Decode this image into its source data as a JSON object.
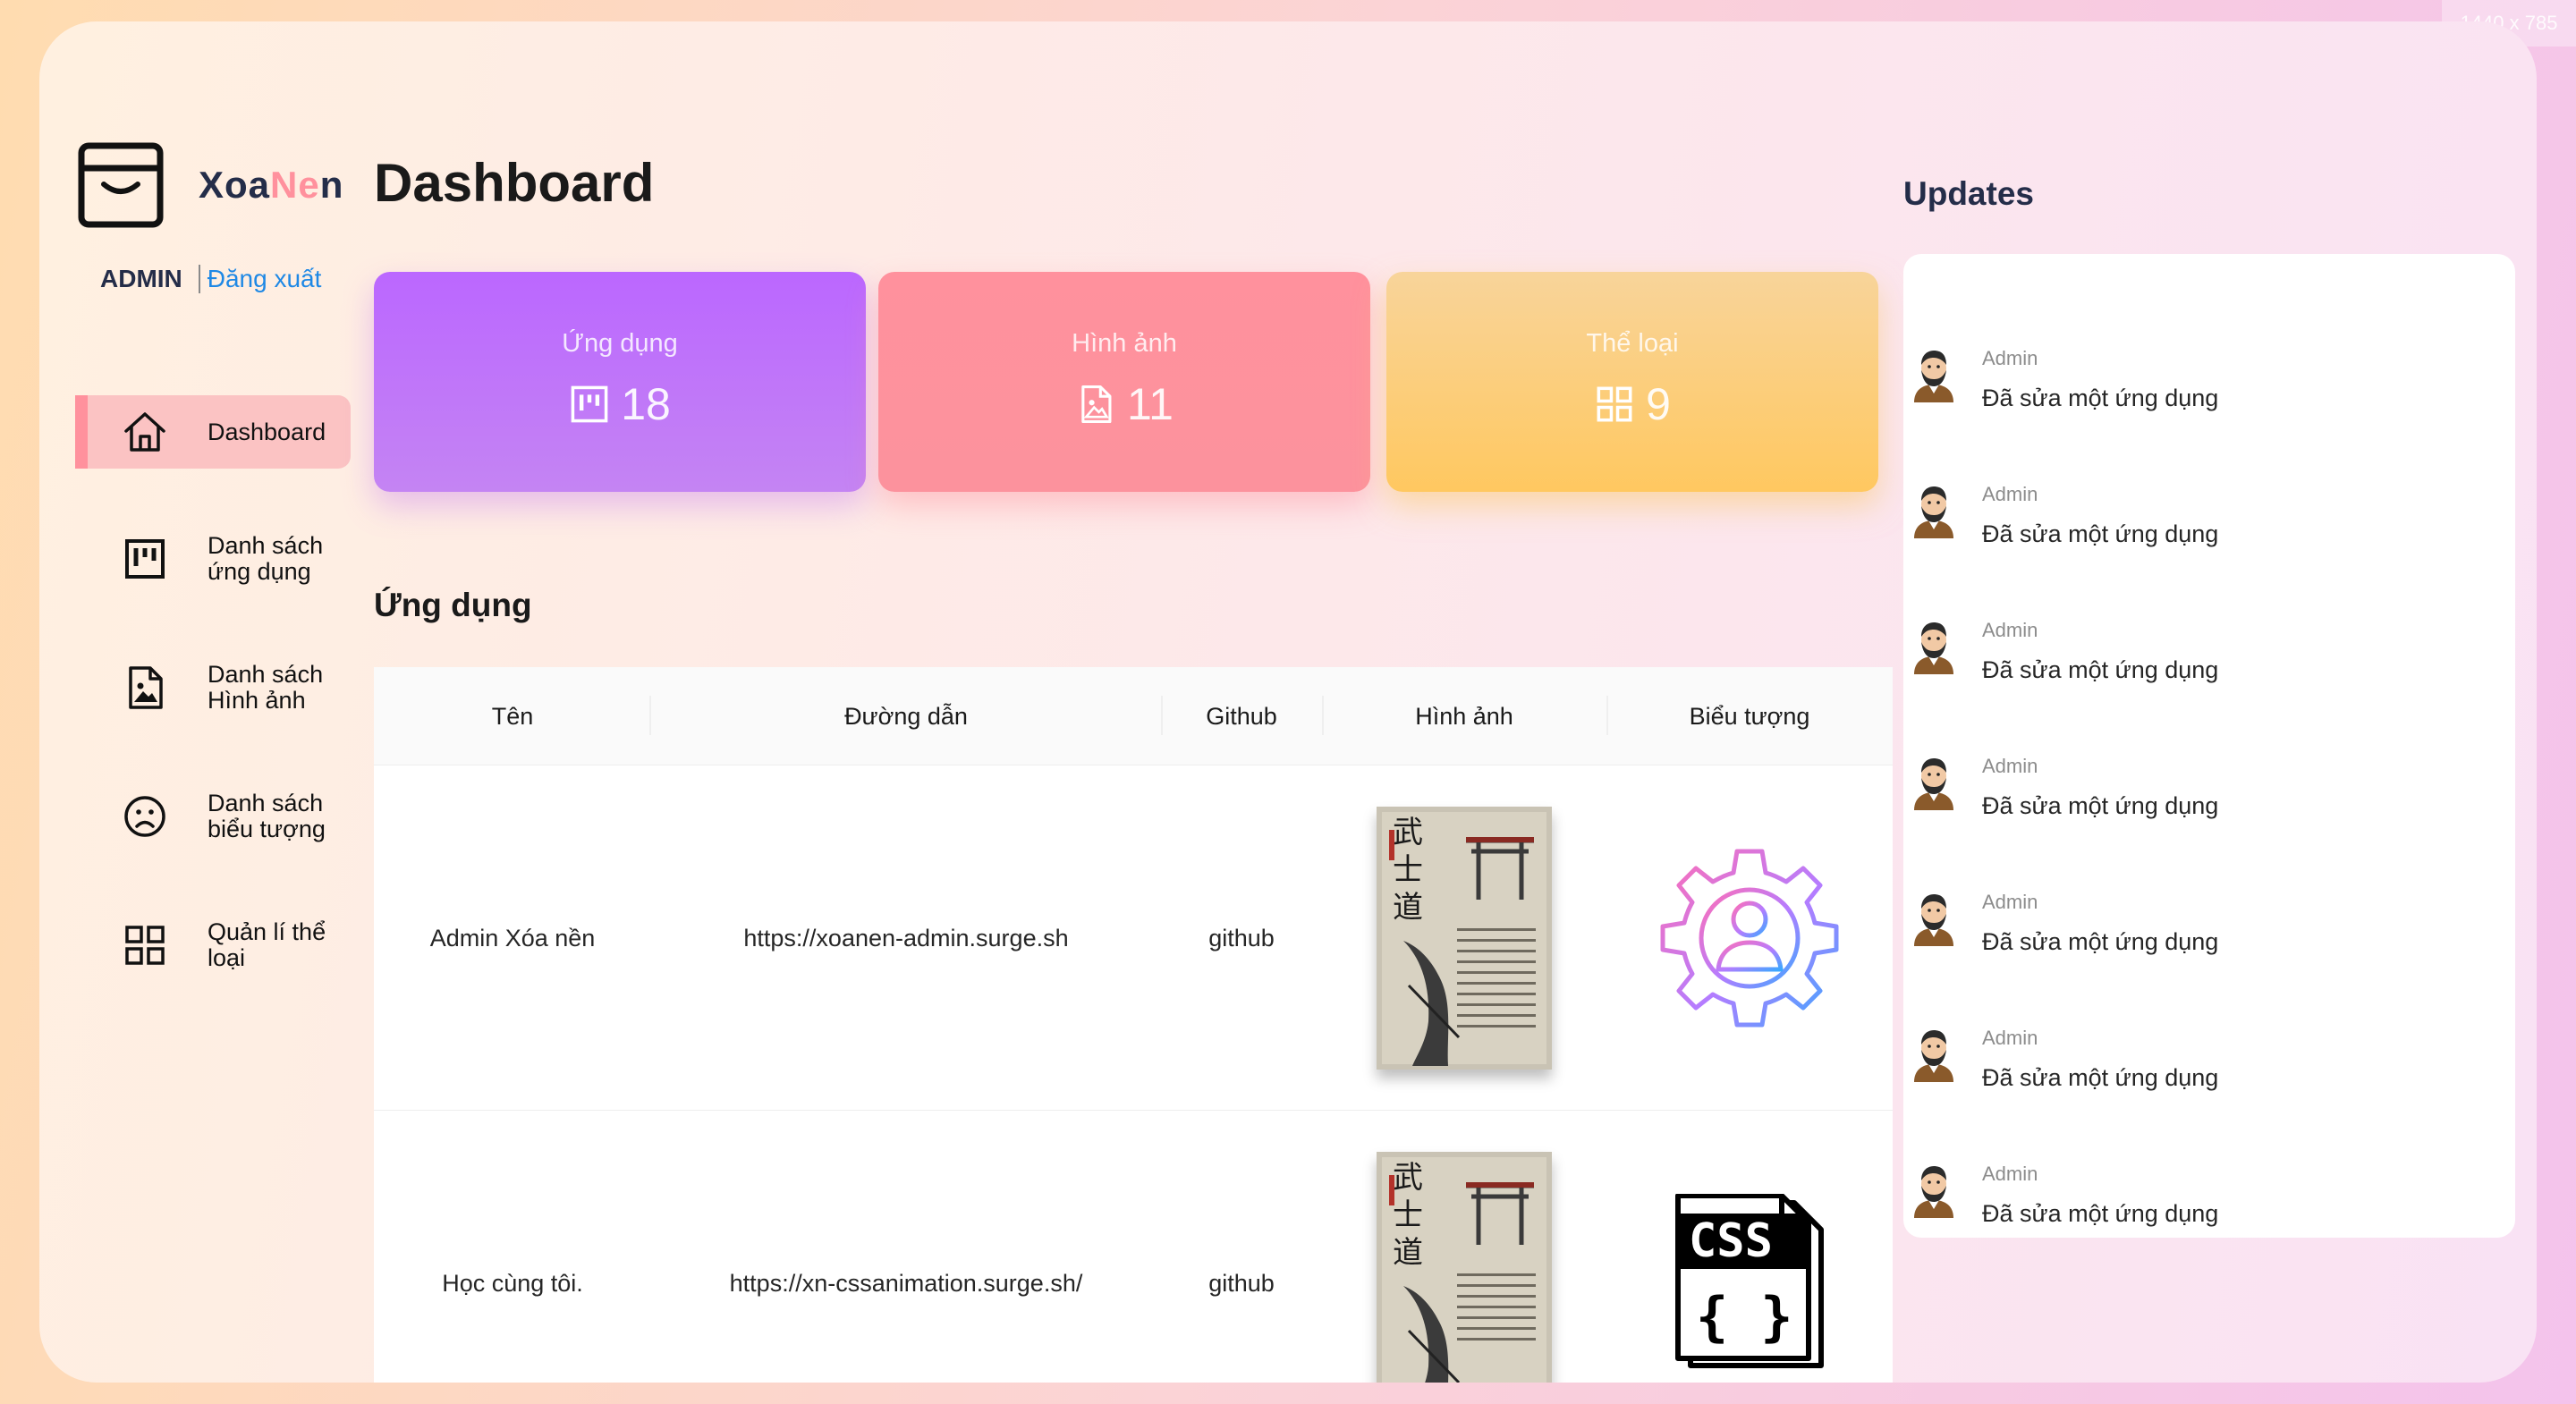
{
  "size_badge": "1440 x 785",
  "brand": {
    "part1": "Xoa",
    "part2": "Ne",
    "part3": "n"
  },
  "user": {
    "name": "ADMIN",
    "logout": "Đăng xuất"
  },
  "sidebar": {
    "items": [
      {
        "label": "Dashboard",
        "icon": "home-icon",
        "active": true
      },
      {
        "label": "Danh sách ứng dụng",
        "icon": "kanban-icon",
        "active": false
      },
      {
        "label": "Danh sách Hình ảnh",
        "icon": "image-file-icon",
        "active": false
      },
      {
        "label": "Danh sách biểu tượng",
        "icon": "sad-face-icon",
        "active": false
      },
      {
        "label": "Quản lí thể loại",
        "icon": "grid-icon",
        "active": false
      }
    ]
  },
  "page": {
    "title": "Dashboard"
  },
  "cards": [
    {
      "title": "Ứng dụng",
      "value": "18",
      "icon": "kanban-icon",
      "color": "#bb67ff"
    },
    {
      "title": "Hình ảnh",
      "value": "11",
      "icon": "image-file-icon",
      "color": "#ff919d"
    },
    {
      "title": "Thể loại",
      "value": "9",
      "icon": "grid-icon",
      "color": "#ffc860"
    }
  ],
  "apps_section": {
    "title": "Ứng dụng",
    "columns": [
      "Tên",
      "Đường dẫn",
      "Github",
      "Hình ảnh",
      "Biểu tượng"
    ],
    "rows": [
      {
        "name": "Admin Xóa nền",
        "url": "https://xoanen-admin.surge.sh",
        "github": "github",
        "image": "samurai-poster-image",
        "icon": "gear-user-icon"
      },
      {
        "name": "Học cùng tôi.",
        "url": "https://xn-cssanimation.surge.sh/",
        "github": "github",
        "image": "samurai-poster-image",
        "icon": "css-file-icon",
        "icon_text": "CSS",
        "icon_braces": "{ }"
      }
    ]
  },
  "updates": {
    "title": "Updates",
    "items": [
      {
        "user": "Admin",
        "message": "Đã sửa một ứng dụng"
      },
      {
        "user": "Admin",
        "message": "Đã sửa một ứng dụng"
      },
      {
        "user": "Admin",
        "message": "Đã sửa một ứng dụng"
      },
      {
        "user": "Admin",
        "message": "Đã sửa một ứng dụng"
      },
      {
        "user": "Admin",
        "message": "Đã sửa một ứng dụng"
      },
      {
        "user": "Admin",
        "message": "Đã sửa một ứng dụng"
      },
      {
        "user": "Admin",
        "message": "Đã sửa một ứng dụng"
      }
    ]
  },
  "colors": {
    "accent_pink": "#ff919d",
    "accent_purple": "#bb67ff",
    "accent_yellow": "#ffc860",
    "link_blue": "#1e88e5",
    "brand_dark": "#242d49"
  }
}
